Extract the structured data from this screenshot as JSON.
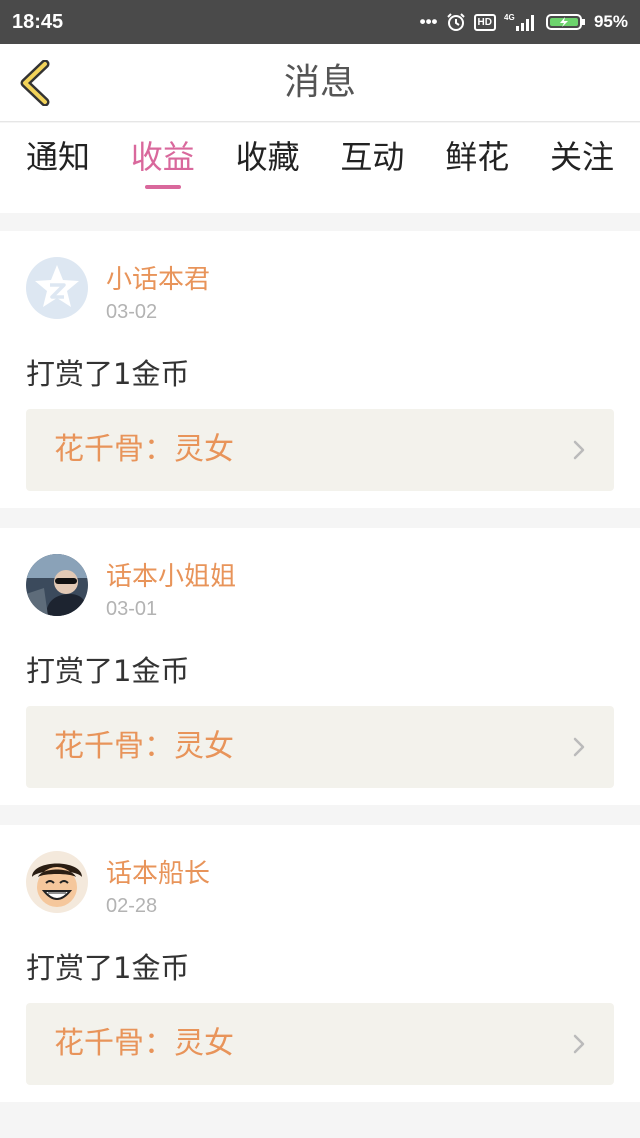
{
  "status_bar": {
    "time": "18:45",
    "dots": "•••",
    "hd": "HD",
    "network": "4G",
    "battery": "95%"
  },
  "header": {
    "title": "消息",
    "back_icon": "chevron-left-icon",
    "accent_color": "#f2d35a"
  },
  "tabs": [
    {
      "label": "通知",
      "active": false
    },
    {
      "label": "收益",
      "active": true
    },
    {
      "label": "收藏",
      "active": false
    },
    {
      "label": "互动",
      "active": false
    },
    {
      "label": "鲜花",
      "active": false
    },
    {
      "label": "关注",
      "active": false
    }
  ],
  "active_tab_color": "#d9689c",
  "messages": [
    {
      "user": "小话本君",
      "date": "03-02",
      "text": "打赏了1金币",
      "work": "花千骨：灵女",
      "avatar": "qzone-avatar"
    },
    {
      "user": "话本小姐姐",
      "date": "03-01",
      "text": "打赏了1金币",
      "work": "花千骨：灵女",
      "avatar": "photo-avatar"
    },
    {
      "user": "话本船长",
      "date": "02-28",
      "text": "打赏了1金币",
      "work": "花千骨：灵女",
      "avatar": "cartoon-avatar"
    }
  ]
}
